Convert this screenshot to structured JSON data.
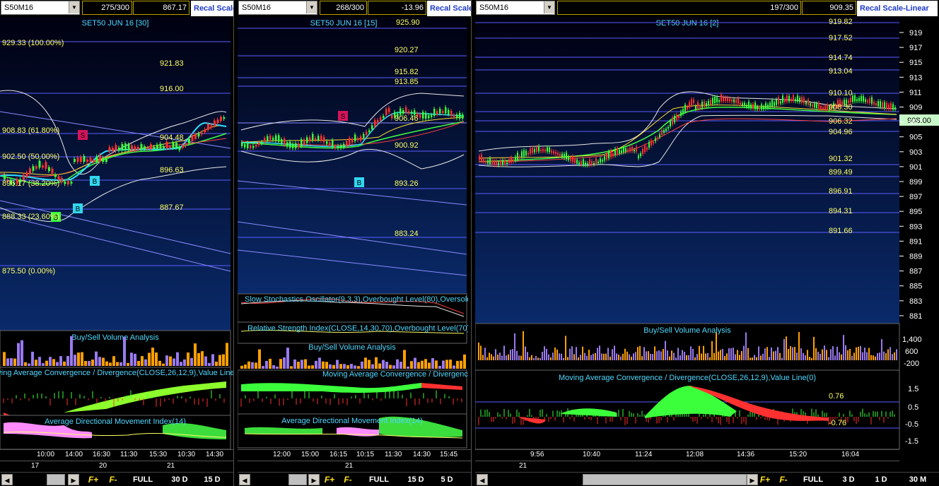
{
  "panes": [
    {
      "symbol": "S50M16",
      "counter": "275/300",
      "last": "867.17",
      "recal": "Recal Scale",
      "chart_title": "SET50 JUN 16  [30]",
      "fib_labels": [
        "929.33 (100.00%)",
        "908.83 (61.80%)",
        "902.50 (50.00%)",
        "896.17 (38.20%)",
        "888.33 (23.60%)",
        "875.50 (0.00%)"
      ],
      "level_labels": [
        "921.83",
        "916.00",
        "904.48",
        "896.63",
        "887.67"
      ],
      "markers": [
        "S",
        "B",
        "B",
        "B"
      ],
      "ind_titles": [
        "Buy/Sell Volume Analysis",
        "Moving Average Convergence / Divergence(CLOSE,26,12,9),Value Line(0)",
        "Average Directional Movement Index(14)"
      ],
      "time_labels": [
        "10:00",
        "14:00",
        "16:30",
        "11:30",
        "15:30",
        "10:30",
        "14:30"
      ],
      "date_labels": [
        "17",
        "20",
        "21"
      ],
      "buttons": [
        "F+",
        "F-",
        "FULL",
        "30 D",
        "15 D"
      ]
    },
    {
      "symbol": "S50M16",
      "counter": "268/300",
      "last": "-13.96",
      "recal": "Recal Scale",
      "chart_title": "SET50 JUN 16  [15]",
      "level_labels": [
        "925.90",
        "920.27",
        "915.82",
        "913.85",
        "906.46",
        "900.92",
        "893.26",
        "883.24"
      ],
      "markers": [
        "S",
        "B"
      ],
      "ind_titles": [
        "Slow Stochastics Oscillator(9,3,3),Overbought Level(80),Oversold Level(20)",
        "Relative Strength Index(CLOSE,14,30,70),Overbought Level(70),Oversold Level(30)",
        "Buy/Sell Volume Analysis",
        "Moving Average Convergence / Divergence(CLOSE,26,12,9),Value Line(0)",
        "Average Directional Movement Index(14)"
      ],
      "time_labels": [
        "12:00",
        "15:00",
        "16:15",
        "10:15",
        "11:30",
        "14:30",
        "15:45"
      ],
      "date_labels": [
        "21"
      ],
      "buttons": [
        "F+",
        "F-",
        "FULL",
        "15 D",
        "5 D"
      ]
    },
    {
      "symbol": "S50M16",
      "counter": "197/300",
      "last": "909.35",
      "recal": "Recal Scale-Linear",
      "chart_title": "SET50 JUN 16  [2]",
      "level_labels": [
        "919.82",
        "917.52",
        "914.74",
        "913.04",
        "910.10",
        "908.30",
        "906.32",
        "904.96",
        "901.32",
        "899.49",
        "896.91",
        "894.31",
        "891.66"
      ],
      "price_tag": "908.00",
      "y_ticks": [
        "919",
        "917",
        "915",
        "913",
        "911",
        "909",
        "907",
        "905",
        "903",
        "901",
        "899",
        "897",
        "895",
        "893",
        "891",
        "889",
        "887",
        "885",
        "883",
        "881"
      ],
      "vol_ticks": [
        "1,400",
        "600",
        "-200"
      ],
      "macd_ticks": [
        "1.5",
        "0.5",
        "-0.5",
        "-1.5"
      ],
      "macd_labels": [
        "0.76",
        "-0.76"
      ],
      "ind_titles": [
        "Buy/Sell Volume Analysis",
        "Moving Average Convergence / Divergence(CLOSE,26,12,9),Value Line(0)"
      ],
      "time_labels": [
        "9:56",
        "10:40",
        "11:24",
        "12:08",
        "14:36",
        "15:20",
        "16:04"
      ],
      "date_labels": [
        "21"
      ],
      "buttons": [
        "F+",
        "F-",
        "FULL",
        "3 D",
        "1 D",
        "30 M"
      ]
    }
  ],
  "chart_data": [
    {
      "type": "line",
      "title": "SET50 JUN 16  [30]",
      "timeframe": "30 minute",
      "x": [
        "10:00",
        "14:00",
        "16:30",
        "11:30",
        "15:30",
        "10:30",
        "14:30"
      ],
      "close": [
        900.5,
        897.0,
        892.0,
        902.0,
        904.0,
        905.5,
        909.0
      ],
      "fib_levels": [
        929.33,
        908.83,
        902.5,
        896.17,
        888.33,
        875.5
      ]
    },
    {
      "type": "line",
      "title": "SET50 JUN 16  [15]",
      "timeframe": "15 minute",
      "x": [
        "12:00",
        "15:00",
        "16:15",
        "10:15",
        "11:30",
        "14:30",
        "15:45"
      ],
      "close": [
        903.5,
        904.5,
        902.0,
        900.5,
        907.0,
        906.8,
        906.0
      ],
      "levels": [
        925.9,
        920.27,
        915.82,
        913.85,
        906.46,
        900.92,
        893.26,
        883.24
      ]
    },
    {
      "type": "line",
      "title": "SET50 JUN 16  [2]",
      "timeframe": "2 minute",
      "x": [
        "9:56",
        "10:40",
        "11:24",
        "12:08",
        "14:36",
        "15:20",
        "16:04"
      ],
      "close": [
        901.0,
        903.0,
        905.5,
        909.5,
        908.5,
        908.0,
        908.0
      ],
      "levels": [
        919.82,
        917.52,
        914.74,
        913.04,
        910.1,
        908.3,
        906.32,
        904.96,
        901.32,
        899.49,
        896.91,
        894.31,
        891.66
      ],
      "ylim": [
        880,
        920
      ]
    }
  ],
  "colors": {
    "title": "#4fd8ff",
    "level": "#ffff66",
    "hline": "#5a5cff",
    "up": "#3cff3c",
    "down": "#ff3030",
    "vol_a": "#ffa000",
    "vol_b": "#9a7af0",
    "sell_marker": "#d4145a",
    "buy_marker": "#30d8f0",
    "buy_marker2": "#3cff3c"
  }
}
